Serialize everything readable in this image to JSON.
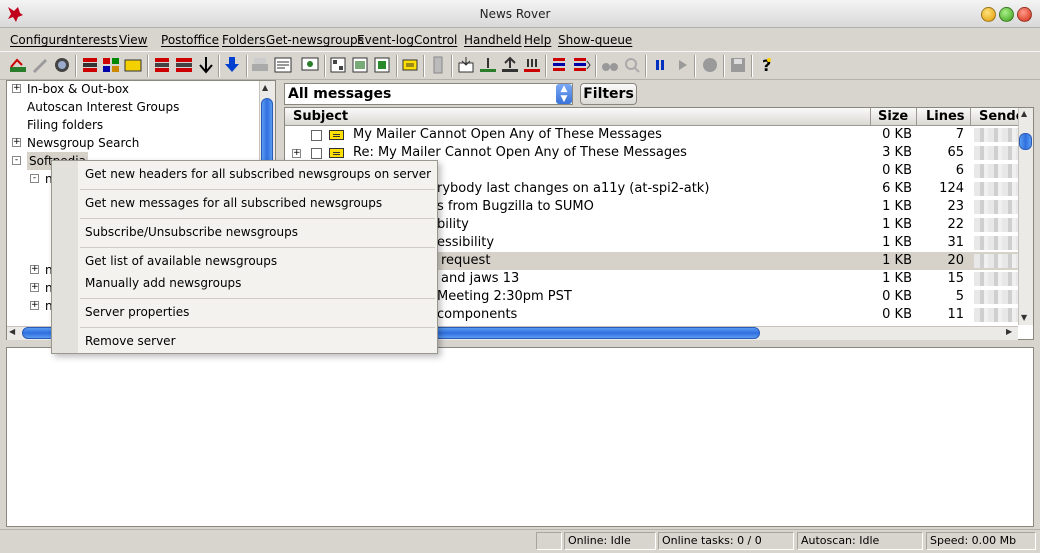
{
  "window": {
    "title": "News Rover"
  },
  "menu": [
    "Configure",
    "Interests",
    "View",
    "Postoffice",
    "Folders",
    "Get-newsgroups",
    "Event-log",
    "Control",
    "Handheld",
    "Help",
    "Show-queue"
  ],
  "toolbar": {
    "icons": [
      "autoscan-icon",
      "edit-icon",
      "globe-icon",
      "headers-icon",
      "grid-icon",
      "folder-icon",
      "download-all-icon",
      "download-grid-icon",
      "down-arrow-icon",
      "blue-down-arrow-icon",
      "print-icon",
      "properties-icon",
      "view-icon",
      "tile-icon",
      "image-icon",
      "image-add-icon",
      "message-icon",
      "handheld-icon",
      "package-icon",
      "upload-icon",
      "upload-multi-icon",
      "upload-grid-icon",
      "queue-icon",
      "queue-all-icon",
      "binoculars-icon",
      "find-icon",
      "pause-icon",
      "play-icon",
      "stop-icon",
      "save-icon",
      "help-icon"
    ]
  },
  "tree": {
    "items": [
      {
        "label": "In-box & Out-box",
        "expander": "+"
      },
      {
        "label": "Autoscan Interest Groups",
        "expander": ""
      },
      {
        "label": "Filing folders",
        "expander": ""
      },
      {
        "label": "Newsgroup Search",
        "expander": "+"
      },
      {
        "label": "Softpedia",
        "expander": "-"
      }
    ],
    "children": [
      "n",
      "n",
      "n",
      "n",
      "n"
    ]
  },
  "filter": {
    "selected": "All messages",
    "button_label": "Filters"
  },
  "columns": {
    "subject": "Subject",
    "size": "Size",
    "lines": "Lines",
    "sender": "Sende"
  },
  "messages": [
    {
      "subject": "My Mailer Cannot Open Any of These Messages",
      "size": "0 KB",
      "lines": "7",
      "expander": ""
    },
    {
      "subject": "Re: My Mailer Cannot Open Any of These Messages",
      "size": "3 KB",
      "lines": "65",
      "expander": "+"
    },
    {
      "subject": "",
      "size": "0 KB",
      "lines": "6",
      "expander": ""
    },
    {
      "subject": "rybody last changes on a11y (at-spi2-atk)",
      "size": "6 KB",
      "lines": "124",
      "expander": ""
    },
    {
      "subject": "s from Bugzilla to SUMO",
      "size": "1 KB",
      "lines": "23",
      "expander": ""
    },
    {
      "subject": "bility",
      "size": "1 KB",
      "lines": "22",
      "expander": ""
    },
    {
      "subject": "essibility",
      "size": "1 KB",
      "lines": "31",
      "expander": ""
    },
    {
      "subject": "request",
      "size": "1 KB",
      "lines": "20",
      "expander": "",
      "selected": true
    },
    {
      "subject": "and jaws 13",
      "size": "1 KB",
      "lines": "15",
      "expander": ""
    },
    {
      "subject": "Meeting 2:30pm PST",
      "size": "0 KB",
      "lines": "5",
      "expander": ""
    },
    {
      "subject": "components",
      "size": "0 KB",
      "lines": "11",
      "expander": ""
    }
  ],
  "context_menu": [
    "Get new headers for all subscribed newsgroups on server",
    "Get new messages for all subscribed newsgroups",
    "Subscribe/Unsubscribe newsgroups",
    "Get list of available newsgroups",
    "Manually add newsgroups",
    "Server properties",
    "Remove server"
  ],
  "status": {
    "online": "Online: Idle",
    "tasks": "Online tasks: 0 / 0",
    "autoscan": "Autoscan: Idle",
    "speed": "Speed: 0.00 Mb"
  }
}
